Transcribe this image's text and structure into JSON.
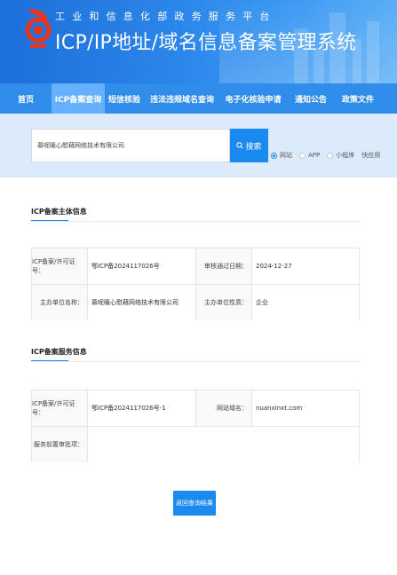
{
  "header": {
    "subtitle": "工业和信息化部政务服务平台",
    "title": "ICP/IP地址/域名信息备案管理系统"
  },
  "nav": {
    "items": [
      {
        "label": "首页",
        "active": false
      },
      {
        "label": "ICP备案查询",
        "active": true
      },
      {
        "label": "短信核验",
        "active": false
      },
      {
        "label": "违法违规域名查询",
        "active": false
      },
      {
        "label": "电子化核验申请",
        "active": false
      },
      {
        "label": "通知公告",
        "active": false
      },
      {
        "label": "政策文件",
        "active": false
      }
    ]
  },
  "search": {
    "value": "慕呢暖心慰藉网络技术有限公司",
    "button_label": "搜索",
    "button_icon": "search-icon",
    "options": [
      {
        "label": "网站",
        "checked": true
      },
      {
        "label": "APP",
        "checked": false
      },
      {
        "label": "小程序",
        "checked": false
      },
      {
        "label": "快应用",
        "checked": false
      }
    ]
  },
  "subject": {
    "title": "ICP备案主体信息",
    "rows": [
      [
        {
          "label": "ICP备案/许可证号：",
          "value": "鄂ICP备2024117026号"
        },
        {
          "label": "审核通过日期：",
          "value": "2024-12-27"
        }
      ],
      [
        {
          "label": "主办单位名称：",
          "value": "慕呢暖心慰藉网络技术有限公司"
        },
        {
          "label": "主办单位性质：",
          "value": "企业"
        }
      ]
    ]
  },
  "service": {
    "title": "ICP备案服务信息",
    "rows": [
      [
        {
          "label": "ICP备案/许可证号：",
          "value": "鄂ICP备2024117026号-1"
        },
        {
          "label": "网站域名：",
          "value": "nuanxinxt.com"
        }
      ],
      [
        {
          "label": "服务前置审批项：",
          "value": ""
        }
      ]
    ]
  },
  "back_button": "返回查询结果",
  "colors": {
    "primary": "#1b8af0",
    "nav_bg": "#2f8ce8",
    "nav_active": "#66b1ff",
    "search_band": "#dcebfb"
  }
}
